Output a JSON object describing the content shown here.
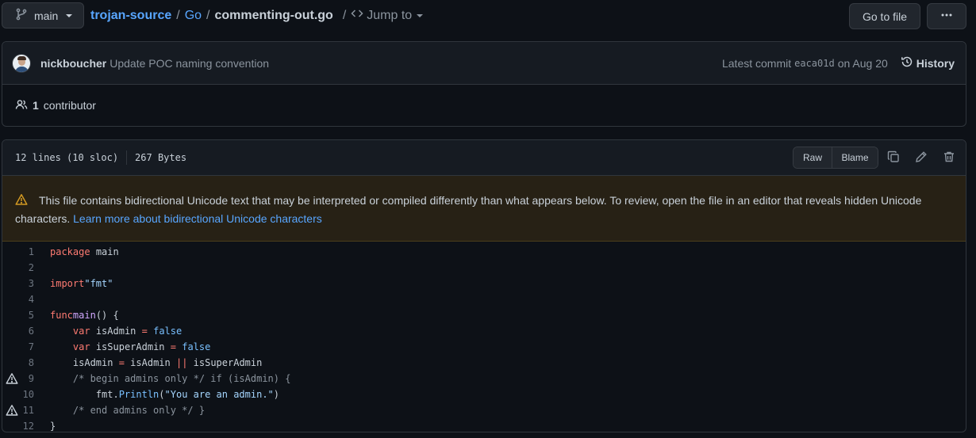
{
  "breadcrumb": {
    "branch": "main",
    "repo": "trojan-source",
    "folder": "Go",
    "file": "commenting-out.go",
    "jump_to": "Jump to",
    "sep1": "/",
    "sep2": "/",
    "sep3": "/"
  },
  "actions": {
    "go_to_file": "Go to file",
    "more": "···"
  },
  "commit": {
    "author": "nickboucher",
    "message": "Update POC naming convention",
    "latest_label": "Latest commit",
    "sha": "eaca01d",
    "date": "on Aug 20",
    "history": "History"
  },
  "contributors": {
    "count": "1",
    "label": "contributor"
  },
  "file": {
    "lines_info": "12 lines (10 sloc)",
    "size": "267 Bytes",
    "raw": "Raw",
    "blame": "Blame"
  },
  "warning": {
    "text": "This file contains bidirectional Unicode text that may be interpreted or compiled differently than what appears below. To review, open the file in an editor that reveals hidden Unicode characters.",
    "link": "Learn more about bidirectional Unicode characters"
  },
  "code": [
    {
      "n": "1",
      "warn": false,
      "tokens": [
        [
          "kw",
          "package"
        ],
        [
          "",
          "main"
        ]
      ]
    },
    {
      "n": "2",
      "warn": false,
      "tokens": []
    },
    {
      "n": "3",
      "warn": false,
      "tokens": [
        [
          "kw",
          "import"
        ],
        [
          "",
          ""
        ],
        [
          "str",
          "\"fmt\""
        ]
      ]
    },
    {
      "n": "4",
      "warn": false,
      "tokens": []
    },
    {
      "n": "5",
      "warn": false,
      "tokens": [
        [
          "kw",
          "func"
        ],
        [
          "",
          ""
        ],
        [
          "fn",
          "main"
        ],
        [
          "",
          "() {"
        ]
      ]
    },
    {
      "n": "6",
      "warn": false,
      "tokens": [
        [
          "",
          "    "
        ],
        [
          "kw",
          "var"
        ],
        [
          "",
          "isAdmin"
        ],
        [
          "kw",
          "="
        ],
        [
          "cst",
          "false"
        ]
      ]
    },
    {
      "n": "7",
      "warn": false,
      "tokens": [
        [
          "",
          "    "
        ],
        [
          "kw",
          "var"
        ],
        [
          "",
          "isSuperAdmin"
        ],
        [
          "kw",
          "="
        ],
        [
          "cst",
          "false"
        ]
      ]
    },
    {
      "n": "8",
      "warn": false,
      "tokens": [
        [
          "",
          "    isAdmin "
        ],
        [
          "kw",
          "="
        ],
        [
          "",
          "isAdmin "
        ],
        [
          "kw",
          "||"
        ],
        [
          "",
          "isSuperAdmin"
        ]
      ]
    },
    {
      "n": "9",
      "warn": true,
      "tokens": [
        [
          "",
          "    "
        ],
        [
          "cm",
          "/* begin admins only */ if (isAdmin) {"
        ]
      ]
    },
    {
      "n": "10",
      "warn": false,
      "tokens": [
        [
          "",
          "        fmt."
        ],
        [
          "cst",
          "Println"
        ],
        [
          "",
          "("
        ],
        [
          "str",
          "\"You are an admin.\""
        ],
        [
          "",
          ")"
        ]
      ]
    },
    {
      "n": "11",
      "warn": true,
      "tokens": [
        [
          "",
          "    "
        ],
        [
          "cm",
          "/* end admins only */ }"
        ]
      ]
    },
    {
      "n": "12",
      "warn": false,
      "tokens": [
        [
          "",
          "}"
        ]
      ]
    }
  ]
}
